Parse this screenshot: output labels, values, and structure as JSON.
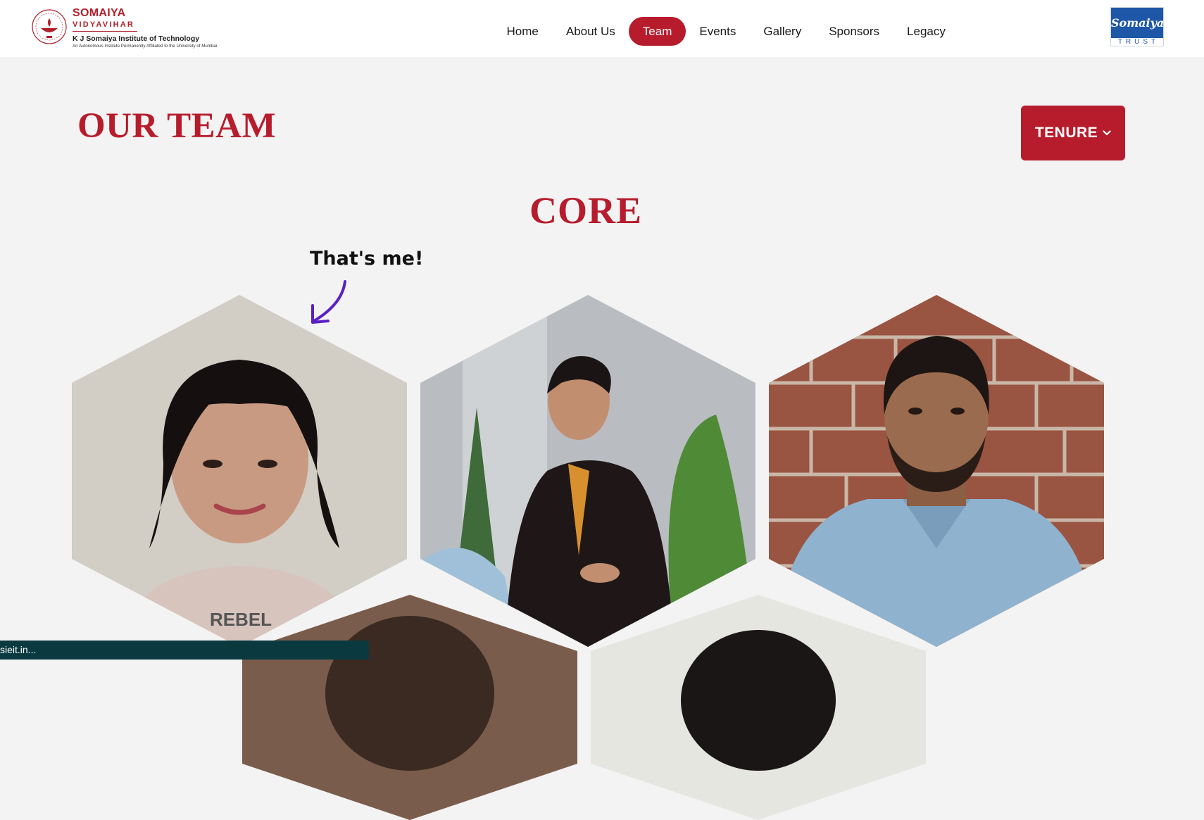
{
  "brand": {
    "name": "SOMAIYA",
    "sub": "VIDYAVIHAR",
    "institute": "K J Somaiya Institute of Technology",
    "affiliation": "An Autonomous Institute Permanently Affiliated to the University of Mumbai",
    "emblem_icon": "diya-lamp-emblem-icon"
  },
  "nav": {
    "items": [
      {
        "label": "Home",
        "active": false
      },
      {
        "label": "About Us",
        "active": false
      },
      {
        "label": "Team",
        "active": true
      },
      {
        "label": "Events",
        "active": false
      },
      {
        "label": "Gallery",
        "active": false
      },
      {
        "label": "Sponsors",
        "active": false
      },
      {
        "label": "Legacy",
        "active": false
      }
    ],
    "active_color": "#b71c2c"
  },
  "trust_logo": {
    "script": "Somaiya",
    "word": "TRUST",
    "color": "#1f57a8"
  },
  "page": {
    "title": "OUR TEAM",
    "tenure_label": "TENURE",
    "tenure_icon": "chevron-down-icon",
    "section_title": "CORE",
    "callout": "That's me!",
    "callout_arrow_icon": "curved-arrow-icon",
    "accent_color": "#b71c2c"
  },
  "members": [
    {
      "photo": "member-photo-1"
    },
    {
      "photo": "member-photo-2"
    },
    {
      "photo": "member-photo-3"
    },
    {
      "photo": "member-photo-4"
    },
    {
      "photo": "member-photo-5"
    }
  ],
  "status_bar": {
    "text": "sieit.in..."
  }
}
